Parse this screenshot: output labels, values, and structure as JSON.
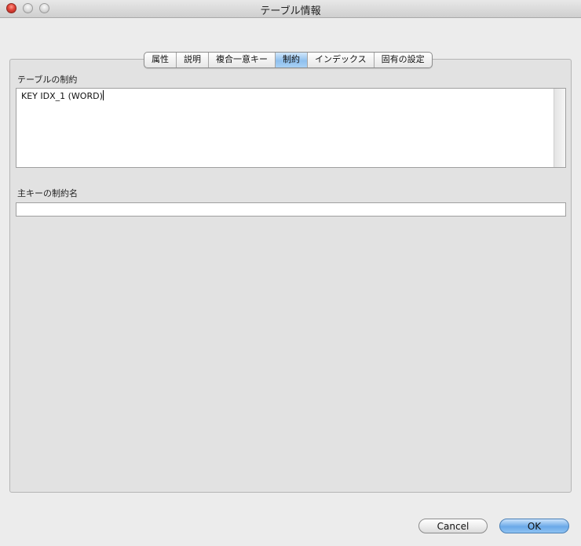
{
  "window": {
    "title": "テーブル情報"
  },
  "tabs": [
    {
      "label": "属性",
      "active": false
    },
    {
      "label": "説明",
      "active": false
    },
    {
      "label": "複合一意キー",
      "active": false
    },
    {
      "label": "制約",
      "active": true
    },
    {
      "label": "インデックス",
      "active": false
    },
    {
      "label": "固有の設定",
      "active": false
    }
  ],
  "constraints": {
    "label": "テーブルの制約",
    "value": "KEY IDX_1 (WORD)"
  },
  "primary_key": {
    "label": "主キーの制約名",
    "value": ""
  },
  "buttons": {
    "cancel": "Cancel",
    "ok": "OK"
  },
  "colors": {
    "active_tab": "#8fc0ee",
    "default_button": "#6aa9e8",
    "close_button": "#e0443a"
  }
}
